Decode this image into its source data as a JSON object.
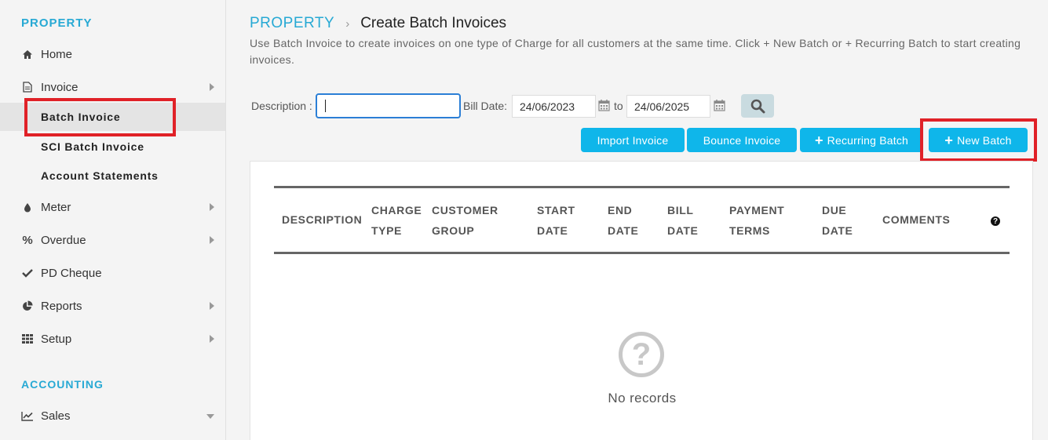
{
  "sidebar": {
    "section_property": "PROPERTY",
    "section_accounting": "ACCOUNTING",
    "items": {
      "home": "Home",
      "invoice": "Invoice",
      "batch_invoice": "Batch Invoice",
      "sci_batch_invoice": "SCI Batch Invoice",
      "account_statements": "Account Statements",
      "meter": "Meter",
      "overdue": "Overdue",
      "pd_cheque": "PD Cheque",
      "reports": "Reports",
      "setup": "Setup",
      "sales": "Sales"
    }
  },
  "header": {
    "breadcrumb_root": "PROPERTY",
    "breadcrumb_sep": "›",
    "title": "Create Batch Invoices",
    "intro": "Use Batch Invoice to create invoices on one type of Charge for all customers at the same time. Click + New Batch or + Recurring Batch to start creating invoices."
  },
  "filters": {
    "description_label": "Description :",
    "description_value": "",
    "bill_date_label": "Bill Date:",
    "date_from": "24/06/2023",
    "to_label": "to",
    "date_to": "24/06/2025"
  },
  "actions": {
    "import_invoice": "Import Invoice",
    "bounce_invoice": "Bounce Invoice",
    "recurring_batch": "Recurring Batch",
    "new_batch": "New Batch"
  },
  "table": {
    "columns": [
      [
        "DESCRIPTION"
      ],
      [
        "CHARGE",
        "TYPE"
      ],
      [
        "CUSTOMER",
        "GROUP"
      ],
      [
        "START",
        "DATE"
      ],
      [
        "END",
        "DATE"
      ],
      [
        "BILL",
        "DATE"
      ],
      [
        "PAYMENT",
        "TERMS"
      ],
      [
        "DUE",
        "DATE"
      ],
      [
        "COMMENTS"
      ]
    ],
    "empty_message": "No records"
  },
  "colors": {
    "accent": "#27a9d4",
    "button": "#0fb6ea",
    "highlight": "#e02127"
  }
}
